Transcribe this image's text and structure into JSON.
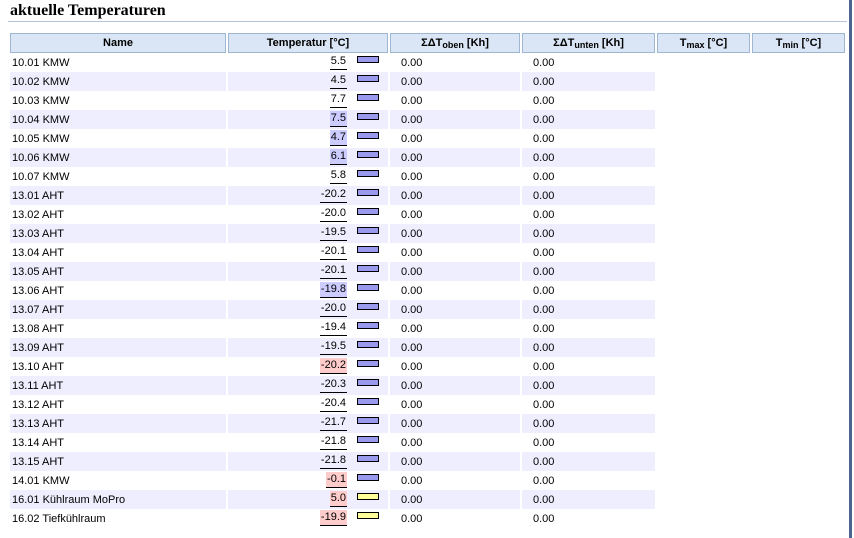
{
  "page": {
    "title": "aktuelle Temperaturen"
  },
  "colors": {
    "header_bg": "#dae6f5",
    "row_alt_bg": "#eeeeff",
    "value_highlight_blue": "#ccccff",
    "value_highlight_red": "#ffcccc",
    "bar_blue": "#9999ee",
    "bar_yellow": "#ffff99",
    "frame_border": "#4b6791"
  },
  "table": {
    "headers": {
      "name": "Name",
      "temperature": "Temperatur [°C]",
      "dt_top_prefix": "ΣΔT",
      "dt_top_sub": "oben",
      "dt_top_suffix": " [Kh]",
      "dt_bottom_prefix": "ΣΔT",
      "dt_bottom_sub": "unten",
      "dt_bottom_suffix": " [Kh]",
      "tmax_prefix": "T",
      "tmax_sub": "max",
      "tmax_suffix": " [°C]",
      "tmin_prefix": "T",
      "tmin_sub": "min",
      "tmin_suffix": " [°C]"
    },
    "rows": [
      {
        "name": "10.01 KMW",
        "temp": "5.5",
        "highlight": "none",
        "bar": "blue",
        "dt_top": "0.00",
        "dt_bottom": "0.00"
      },
      {
        "name": "10.02 KMW",
        "temp": "4.5",
        "highlight": "none",
        "bar": "blue",
        "dt_top": "0.00",
        "dt_bottom": "0.00"
      },
      {
        "name": "10.03 KMW",
        "temp": "7.7",
        "highlight": "none",
        "bar": "blue",
        "dt_top": "0.00",
        "dt_bottom": "0.00"
      },
      {
        "name": "10.04 KMW",
        "temp": "7.5",
        "highlight": "blue",
        "bar": "blue",
        "dt_top": "0.00",
        "dt_bottom": "0.00"
      },
      {
        "name": "10.05 KMW",
        "temp": "4.7",
        "highlight": "blue",
        "bar": "blue",
        "dt_top": "0.00",
        "dt_bottom": "0.00"
      },
      {
        "name": "10.06 KMW",
        "temp": "6.1",
        "highlight": "blue",
        "bar": "blue",
        "dt_top": "0.00",
        "dt_bottom": "0.00"
      },
      {
        "name": "10.07 KMW",
        "temp": "5.8",
        "highlight": "none",
        "bar": "blue",
        "dt_top": "0.00",
        "dt_bottom": "0.00"
      },
      {
        "name": "13.01 AHT",
        "temp": "-20.2",
        "highlight": "none",
        "bar": "blue",
        "dt_top": "0.00",
        "dt_bottom": "0.00"
      },
      {
        "name": "13.02 AHT",
        "temp": "-20.0",
        "highlight": "none",
        "bar": "blue",
        "dt_top": "0.00",
        "dt_bottom": "0.00"
      },
      {
        "name": "13.03 AHT",
        "temp": "-19.5",
        "highlight": "none",
        "bar": "blue",
        "dt_top": "0.00",
        "dt_bottom": "0.00"
      },
      {
        "name": "13.04 AHT",
        "temp": "-20.1",
        "highlight": "none",
        "bar": "blue",
        "dt_top": "0.00",
        "dt_bottom": "0.00"
      },
      {
        "name": "13.05 AHT",
        "temp": "-20.1",
        "highlight": "none",
        "bar": "blue",
        "dt_top": "0.00",
        "dt_bottom": "0.00"
      },
      {
        "name": "13.06 AHT",
        "temp": "-19.8",
        "highlight": "blue",
        "bar": "blue",
        "dt_top": "0.00",
        "dt_bottom": "0.00"
      },
      {
        "name": "13.07 AHT",
        "temp": "-20.0",
        "highlight": "none",
        "bar": "blue",
        "dt_top": "0.00",
        "dt_bottom": "0.00"
      },
      {
        "name": "13.08 AHT",
        "temp": "-19.4",
        "highlight": "none",
        "bar": "blue",
        "dt_top": "0.00",
        "dt_bottom": "0.00"
      },
      {
        "name": "13.09 AHT",
        "temp": "-19.5",
        "highlight": "none",
        "bar": "blue",
        "dt_top": "0.00",
        "dt_bottom": "0.00"
      },
      {
        "name": "13.10 AHT",
        "temp": "-20.2",
        "highlight": "red",
        "bar": "blue",
        "dt_top": "0.00",
        "dt_bottom": "0.00"
      },
      {
        "name": "13.11 AHT",
        "temp": "-20.3",
        "highlight": "none",
        "bar": "blue",
        "dt_top": "0.00",
        "dt_bottom": "0.00"
      },
      {
        "name": "13.12 AHT",
        "temp": "-20.4",
        "highlight": "none",
        "bar": "blue",
        "dt_top": "0.00",
        "dt_bottom": "0.00"
      },
      {
        "name": "13.13 AHT",
        "temp": "-21.7",
        "highlight": "none",
        "bar": "blue",
        "dt_top": "0.00",
        "dt_bottom": "0.00"
      },
      {
        "name": "13.14 AHT",
        "temp": "-21.8",
        "highlight": "none",
        "bar": "blue",
        "dt_top": "0.00",
        "dt_bottom": "0.00"
      },
      {
        "name": "13.15 AHT",
        "temp": "-21.8",
        "highlight": "none",
        "bar": "blue",
        "dt_top": "0.00",
        "dt_bottom": "0.00"
      },
      {
        "name": "14.01 KMW",
        "temp": "-0.1",
        "highlight": "red",
        "bar": "blue",
        "dt_top": "0.00",
        "dt_bottom": "0.00"
      },
      {
        "name": "16.01 Kühlraum MoPro",
        "temp": "5.0",
        "highlight": "red",
        "bar": "yellow",
        "dt_top": "0.00",
        "dt_bottom": "0.00"
      },
      {
        "name": "16.02 Tiefkühlraum",
        "temp": "-19.9",
        "highlight": "red",
        "bar": "yellow",
        "dt_top": "0.00",
        "dt_bottom": "0.00"
      }
    ]
  }
}
